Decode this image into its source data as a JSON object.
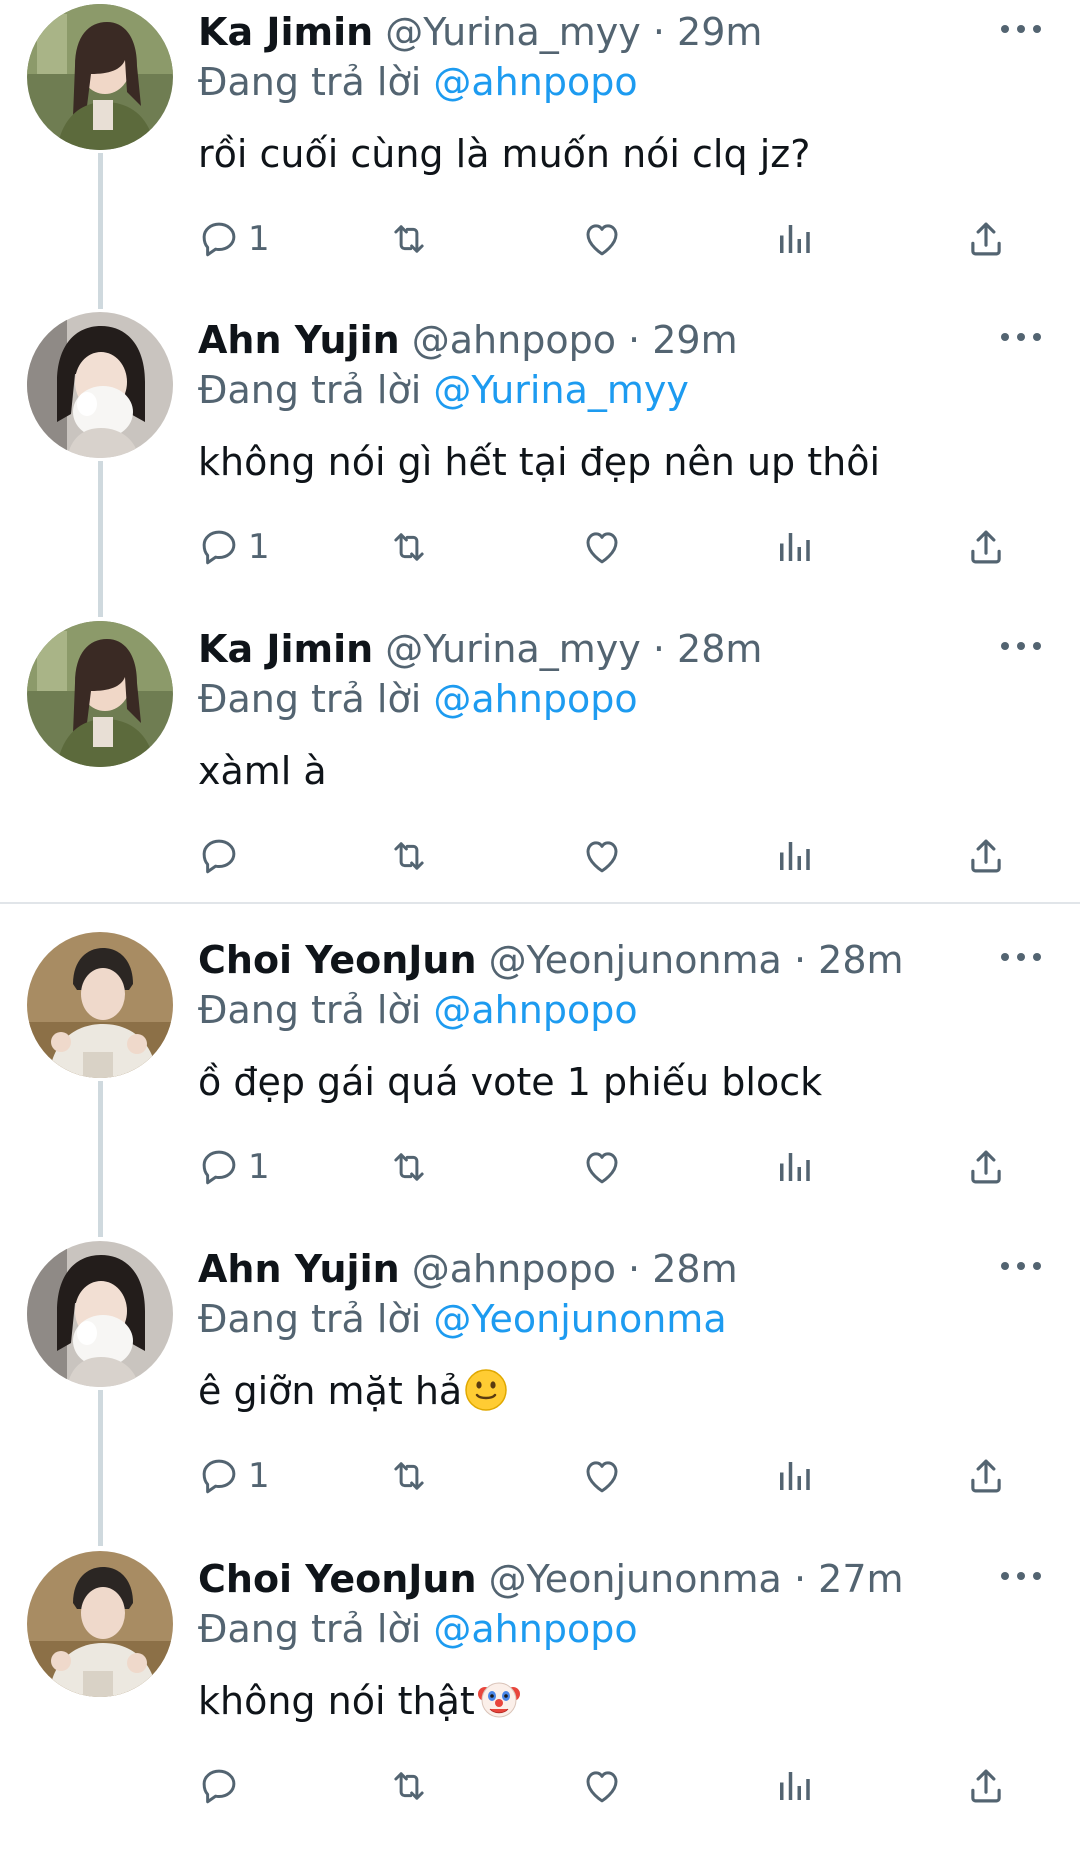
{
  "thread": {
    "replying_prefix": "Đang trả lời",
    "tweets": [
      {
        "name": "Ka Jimin",
        "handle": "@Yurina_myy",
        "separator": "·",
        "time": "29m",
        "replying_to": "@ahnpopo",
        "text": "rồi cuối cùng là muốn nói clq jz?",
        "reply_count": "1",
        "avatar": "ka-jimin",
        "has_thread_line": true,
        "emoji": ""
      },
      {
        "name": "Ahn Yujin",
        "handle": "@ahnpopo",
        "separator": "·",
        "time": "29m",
        "replying_to": "@Yurina_myy",
        "text": "không nói gì hết tại đẹp nên up thôi",
        "reply_count": "1",
        "avatar": "ahn-yujin",
        "has_thread_line": true,
        "emoji": ""
      },
      {
        "name": "Ka Jimin",
        "handle": "@Yurina_myy",
        "separator": "·",
        "time": "28m",
        "replying_to": "@ahnpopo",
        "text": "xàml à",
        "reply_count": "",
        "avatar": "ka-jimin",
        "has_thread_line": false,
        "emoji": ""
      },
      {
        "name": "Choi YeonJun",
        "handle": "@Yeonjunonma",
        "separator": "·",
        "time": "28m",
        "replying_to": "@ahnpopo",
        "text": "ồ đẹp gái quá vote 1 phiếu block",
        "reply_count": "1",
        "avatar": "choi-yeonjun",
        "has_thread_line": true,
        "emoji": ""
      },
      {
        "name": "Ahn Yujin",
        "handle": "@ahnpopo",
        "separator": "·",
        "time": "28m",
        "replying_to": "@Yeonjunonma",
        "text": "ê giỡn mặt hả",
        "reply_count": "1",
        "avatar": "ahn-yujin",
        "has_thread_line": true,
        "emoji": "slightly-smiling-face-emoji"
      },
      {
        "name": "Choi YeonJun",
        "handle": "@Yeonjunonma",
        "separator": "·",
        "time": "27m",
        "replying_to": "@ahnpopo",
        "text": "không nói thật",
        "reply_count": "",
        "avatar": "choi-yeonjun",
        "has_thread_line": false,
        "emoji": "clown-face-emoji"
      }
    ]
  },
  "icons": {
    "reply": "reply-icon",
    "retweet": "retweet-icon",
    "like": "heart-icon",
    "views": "views-icon",
    "share": "share-icon",
    "more": "more-options-icon"
  },
  "colors": {
    "text": "#0f1419",
    "secondary": "#536471",
    "link": "#1d9bf0",
    "thread_line": "#cfd9de"
  }
}
